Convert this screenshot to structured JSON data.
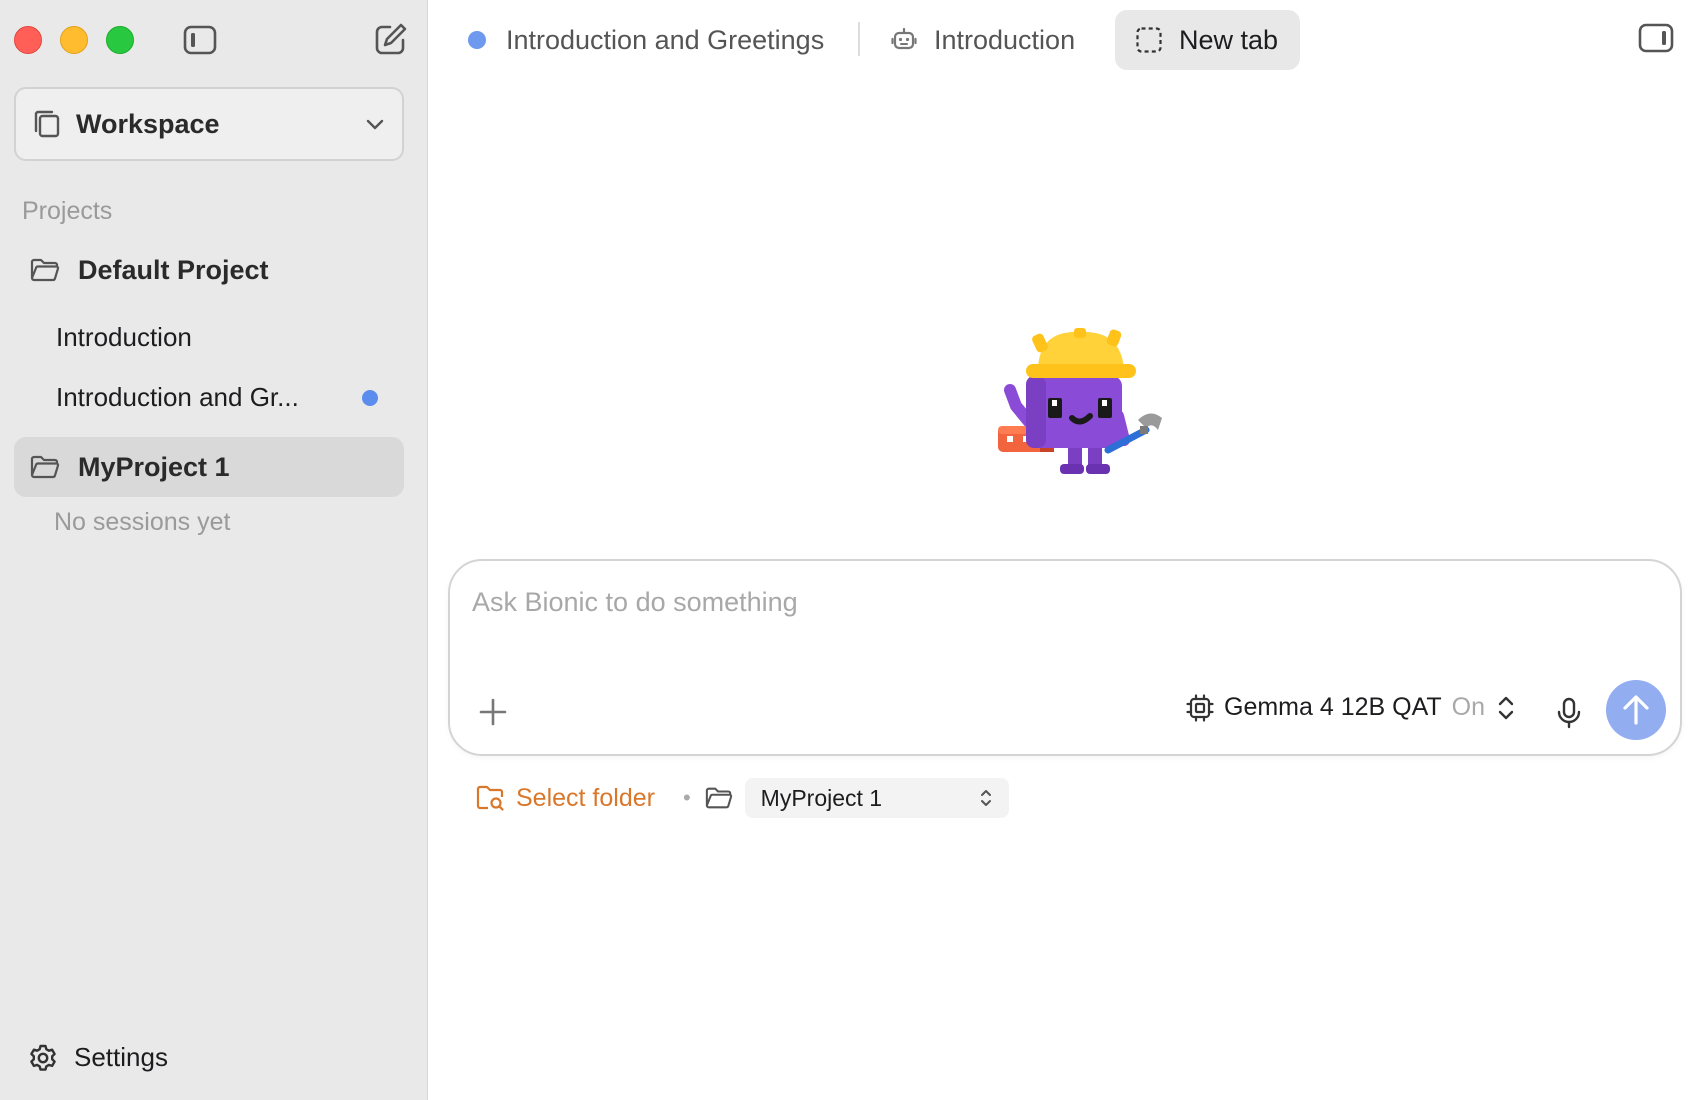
{
  "sidebar": {
    "workspace_label": "Workspace",
    "projects_heading": "Projects",
    "projects": [
      {
        "name": "Default Project",
        "sessions": [
          {
            "title": "Introduction",
            "unread": false
          },
          {
            "title": "Introduction and Gr...",
            "unread": true
          }
        ]
      },
      {
        "name": "MyProject 1",
        "selected": true,
        "empty_note": "No sessions yet"
      }
    ],
    "settings_label": "Settings"
  },
  "tabs": [
    {
      "label": "Introduction and Greetings",
      "icon": "status-dot"
    },
    {
      "label": "Introduction",
      "icon": "robot-icon"
    },
    {
      "label": "New tab",
      "icon": "dashed-square-icon",
      "active": true
    }
  ],
  "composer": {
    "placeholder": "Ask Bionic to do something",
    "model_name": "Gemma 4 12B QAT",
    "model_state": "On"
  },
  "folder_bar": {
    "select_folder_label": "Select folder",
    "separator": "•",
    "project_value": "MyProject 1"
  },
  "colors": {
    "accent_blue": "#5b8def",
    "send_button": "#92aef1",
    "select_folder_orange": "#d9772b",
    "sidebar_bg": "#e9e9e9"
  }
}
